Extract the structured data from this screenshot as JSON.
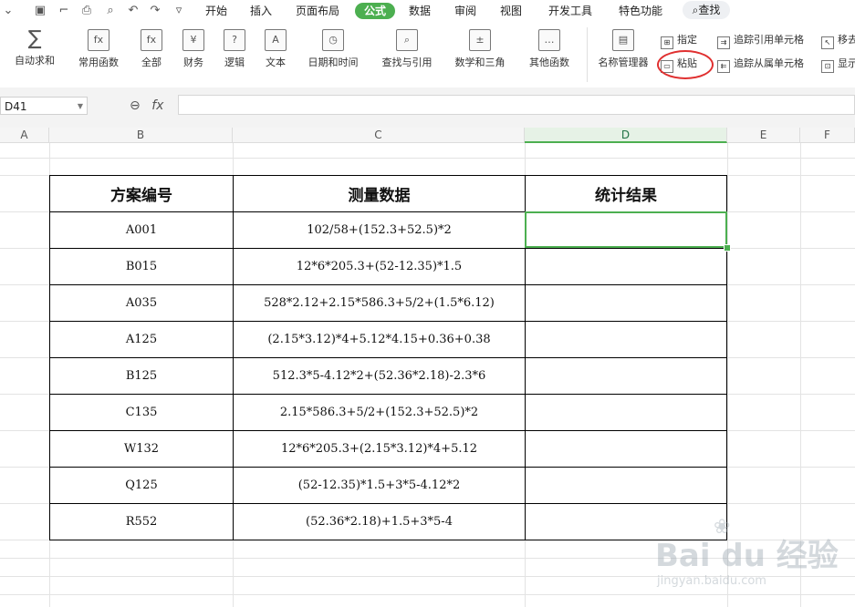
{
  "menubar": {
    "quick_icons": [
      "chevron-down-icon",
      "save-icon",
      "format-painter-icon",
      "print-icon",
      "print-preview-icon",
      "undo-icon",
      "redo-icon",
      "customize-icon"
    ],
    "tabs": [
      "开始",
      "插入",
      "页面布局",
      "公式",
      "数据",
      "审阅",
      "视图",
      "开发工具",
      "特色功能"
    ],
    "active_tab": "公式",
    "search_label": "查找"
  },
  "ribbon": {
    "buttons": [
      {
        "label": "自动求和",
        "icon": "sum-icon",
        "glyph": "∑"
      },
      {
        "label": "常用函数",
        "icon": "common-function-icon",
        "glyph": "fx"
      },
      {
        "label": "全部",
        "icon": "all-functions-icon",
        "glyph": "fx"
      },
      {
        "label": "财务",
        "icon": "finance-icon",
        "glyph": "¥"
      },
      {
        "label": "逻辑",
        "icon": "logic-icon",
        "glyph": "?"
      },
      {
        "label": "文本",
        "icon": "text-function-icon",
        "glyph": "A"
      },
      {
        "label": "日期和时间",
        "icon": "datetime-icon",
        "glyph": "◷"
      },
      {
        "label": "查找与引用",
        "icon": "lookup-icon",
        "glyph": "⌕"
      },
      {
        "label": "数学和三角",
        "icon": "math-trig-icon",
        "glyph": "±"
      },
      {
        "label": "其他函数",
        "icon": "other-functions-icon",
        "glyph": "…"
      },
      {
        "label": "名称管理器",
        "icon": "name-manager-icon",
        "glyph": "▤"
      }
    ],
    "small_buttons": {
      "specify": "指定",
      "paste": "粘贴",
      "trace_precedents": "追踪引用单元格",
      "trace_dependents": "追踪从属单元格",
      "remove_arrows": "移去",
      "show": "显示"
    }
  },
  "formula_bar": {
    "name_box": "D41",
    "fx_label": "fx",
    "formula": ""
  },
  "columns": [
    "A",
    "B",
    "C",
    "D",
    "E",
    "F"
  ],
  "selected_column": "D",
  "table": {
    "headers": [
      "方案编号",
      "测量数据",
      "统计结果"
    ],
    "rows": [
      [
        "A001",
        "102/58+(152.3+52.5)*2",
        ""
      ],
      [
        "B015",
        "12*6*205.3+(52-12.35)*1.5",
        ""
      ],
      [
        "A035",
        "528*2.12+2.15*586.3+5/2+(1.5*6.12)",
        ""
      ],
      [
        "A125",
        "(2.15*3.12)*4+5.12*4.15+0.36+0.38",
        ""
      ],
      [
        "B125",
        "512.3*5-4.12*2+(52.36*2.18)-2.3*6",
        ""
      ],
      [
        "C135",
        "2.15*586.3+5/2+(152.3+52.5)*2",
        ""
      ],
      [
        "W132",
        "12*6*205.3+(2.15*3.12)*4+5.12",
        ""
      ],
      [
        "Q125",
        "(52-12.35)*1.5+3*5-4.12*2",
        ""
      ],
      [
        "R552",
        "(52.36*2.18)+1.5+3*5-4",
        ""
      ]
    ]
  },
  "watermark": {
    "main": "Bai du 经验",
    "sub": "jingyan.baidu.com"
  }
}
